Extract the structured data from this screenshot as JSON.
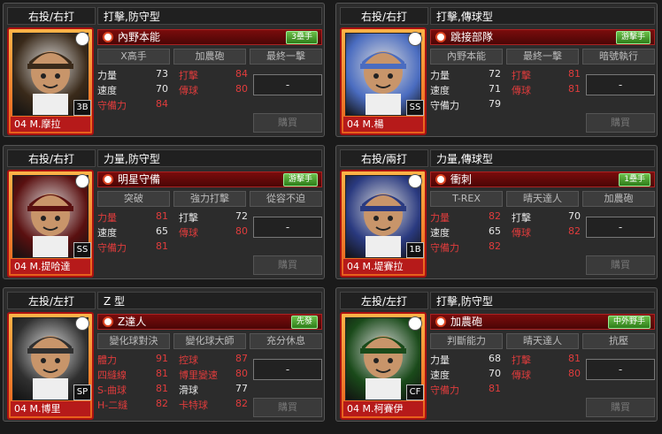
{
  "players": [
    {
      "hand": "右投/右打",
      "type": "打擊,防守型",
      "card_name": "04 M.摩拉",
      "position_badge": "3B",
      "skill": "內野本能",
      "skill_tag": "3壘手",
      "sub_skills": [
        "X高手",
        "加農砲",
        "最終一擊"
      ],
      "stats": [
        {
          "label": "力量",
          "value": "73",
          "color": "white"
        },
        {
          "label": "打擊",
          "value": "84",
          "color": "red"
        },
        {
          "label": "速度",
          "value": "70",
          "color": "white"
        },
        {
          "label": "傳球",
          "value": "80",
          "color": "red"
        },
        {
          "label": "守備力",
          "value": "84",
          "color": "red"
        }
      ],
      "input_value": "-",
      "buy_label": "購買",
      "card_color": "#e8601c"
    },
    {
      "hand": "右投/右打",
      "type": "打擊,傳球型",
      "card_name": "04 M.楊",
      "position_badge": "SS",
      "skill": "跳接部隊",
      "skill_tag": "游擊手",
      "sub_skills": [
        "內野本能",
        "最終一擊",
        "暗號執行"
      ],
      "stats": [
        {
          "label": "力量",
          "value": "72",
          "color": "white"
        },
        {
          "label": "打擊",
          "value": "81",
          "color": "red"
        },
        {
          "label": "速度",
          "value": "71",
          "color": "white"
        },
        {
          "label": "傳球",
          "value": "81",
          "color": "red"
        },
        {
          "label": "守備力",
          "value": "79",
          "color": "white"
        }
      ],
      "input_value": "-",
      "buy_label": "購買",
      "card_color": "#e8601c"
    },
    {
      "hand": "右投/右打",
      "type": "力量,防守型",
      "card_name": "04 M.提哈達",
      "position_badge": "SS",
      "skill": "明星守備",
      "skill_tag": "游擊手",
      "sub_skills": [
        "突破",
        "強力打擊",
        "從容不迫"
      ],
      "stats": [
        {
          "label": "力量",
          "value": "81",
          "color": "red"
        },
        {
          "label": "打擊",
          "value": "72",
          "color": "white"
        },
        {
          "label": "速度",
          "value": "65",
          "color": "white"
        },
        {
          "label": "傳球",
          "value": "80",
          "color": "red"
        },
        {
          "label": "守備力",
          "value": "81",
          "color": "red"
        }
      ],
      "input_value": "-",
      "buy_label": "購買",
      "card_color": "#e8601c"
    },
    {
      "hand": "右投/兩打",
      "type": "力量,傳球型",
      "card_name": "04 M.堤賽拉",
      "position_badge": "1B",
      "skill": "衝刺",
      "skill_tag": "1壘手",
      "sub_skills": [
        "T-REX",
        "晴天達人",
        "加農砲"
      ],
      "stats": [
        {
          "label": "力量",
          "value": "82",
          "color": "red"
        },
        {
          "label": "打擊",
          "value": "70",
          "color": "white"
        },
        {
          "label": "速度",
          "value": "65",
          "color": "white"
        },
        {
          "label": "傳球",
          "value": "82",
          "color": "red"
        },
        {
          "label": "守備力",
          "value": "82",
          "color": "red"
        }
      ],
      "input_value": "-",
      "buy_label": "購買",
      "card_color": "#e8601c"
    },
    {
      "hand": "左投/左打",
      "type": "Z 型",
      "card_name": "04 M.博里",
      "position_badge": "SP",
      "skill": "Z達人",
      "skill_tag": "先發",
      "sub_skills": [
        "變化球對決",
        "變化球大師",
        "充分休息"
      ],
      "stats": [
        {
          "label": "體力",
          "value": "91",
          "color": "red"
        },
        {
          "label": "控球",
          "value": "87",
          "color": "red"
        },
        {
          "label": "四縫線",
          "value": "81",
          "color": "red"
        },
        {
          "label": "博里變速",
          "value": "80",
          "color": "red"
        },
        {
          "label": "S-曲球",
          "value": "81",
          "color": "red"
        },
        {
          "label": "滑球",
          "value": "77",
          "color": "white"
        },
        {
          "label": "H-二縫",
          "value": "82",
          "color": "red"
        },
        {
          "label": "卡特球",
          "value": "82",
          "color": "red"
        }
      ],
      "input_value": "-",
      "buy_label": "購買",
      "card_color": "#e8601c"
    },
    {
      "hand": "左投/左打",
      "type": "打擊,防守型",
      "card_name": "04 M.柯賽伊",
      "position_badge": "CF",
      "skill": "加農砲",
      "skill_tag": "中外野手",
      "sub_skills": [
        "判斷能力",
        "晴天達人",
        "抗壓"
      ],
      "stats": [
        {
          "label": "力量",
          "value": "68",
          "color": "white"
        },
        {
          "label": "打擊",
          "value": "81",
          "color": "red"
        },
        {
          "label": "速度",
          "value": "70",
          "color": "white"
        },
        {
          "label": "傳球",
          "value": "80",
          "color": "red"
        },
        {
          "label": "守備力",
          "value": "81",
          "color": "red"
        }
      ],
      "input_value": "-",
      "buy_label": "購買",
      "card_color": "#e8601c"
    }
  ]
}
